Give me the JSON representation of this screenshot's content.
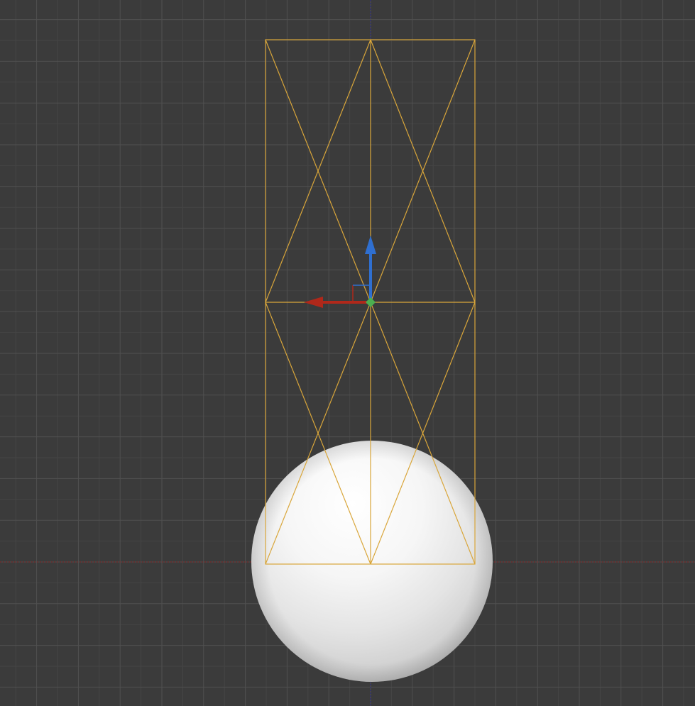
{
  "viewport": {
    "view": "front",
    "background_color": "#3b3b3b",
    "grid": {
      "visible": true,
      "minor_color": "#454545",
      "major_color": "#505050"
    },
    "world_axes": {
      "horizontal_axis_color": "#8a2a2a",
      "vertical_axis_color": "#2d2d8c"
    }
  },
  "scene": {
    "objects": [
      {
        "name": "sphere",
        "type": "mesh",
        "shading": "smooth",
        "color": "#f2f2f2",
        "selected": false
      },
      {
        "name": "wireframe-box",
        "type": "mesh",
        "display": "wireframe",
        "color": "#d9a63a",
        "selected": true
      }
    ]
  },
  "gizmo": {
    "type": "translate",
    "x_axis_color": "#b0281a",
    "z_axis_color": "#2f6fd0",
    "pivot_color": "#4caf50"
  }
}
